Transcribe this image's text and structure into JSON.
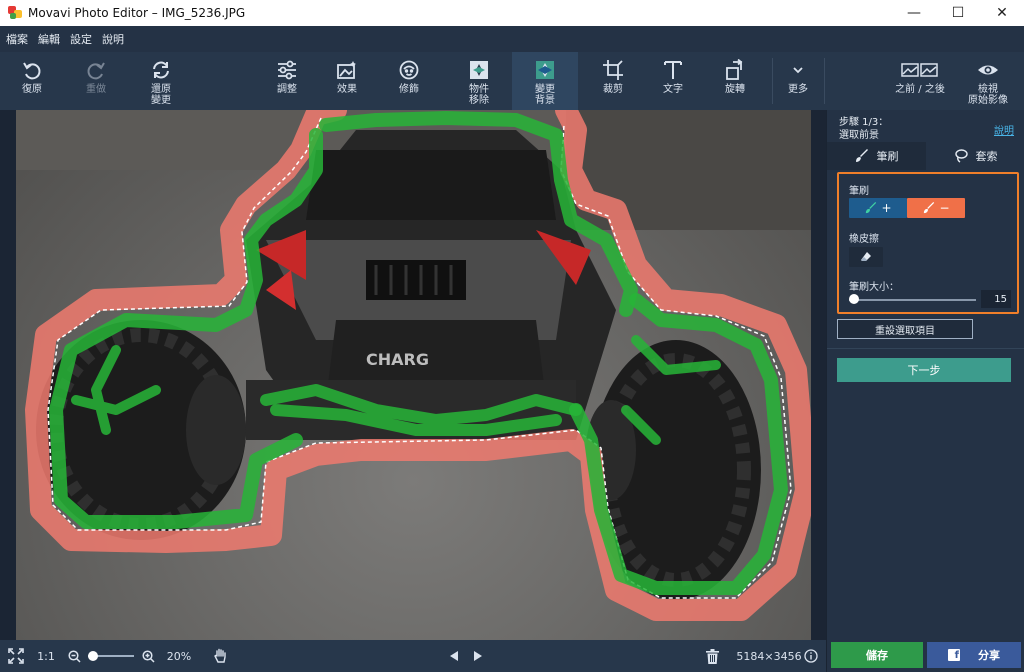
{
  "window": {
    "title": "Movavi Photo Editor – IMG_5236.JPG",
    "minimize": "—",
    "maximize": "☐",
    "close": "✕"
  },
  "menu": [
    "檔案",
    "編輯",
    "設定",
    "說明"
  ],
  "toolbar": {
    "undo": "復原",
    "redo": "重做",
    "restore": "還原\n變更",
    "adjust": "調整",
    "effects": "效果",
    "retouch": "修飾",
    "object_removal": "物件\n移除",
    "change_background": "變更\n背景",
    "crop": "裁剪",
    "text": "文字",
    "rotate": "旋轉",
    "more": "更多",
    "before_after": "之前 / 之後",
    "view_original": "檢視\n原始影像"
  },
  "panel": {
    "step_line1": "步驟 1/3：",
    "step_line2": "選取前景",
    "help": "說明",
    "tabs": [
      "筆刷",
      "套索"
    ],
    "brush_section": "筆刷",
    "brush_add": "+",
    "brush_remove": "−",
    "eraser_section": "橡皮擦",
    "brush_size_label": "筆刷大小：",
    "brush_size_value": "15",
    "brush_size_fraction": 0.04,
    "reset_selection": "重設選取項目",
    "next_step": "下一步",
    "save": "儲存",
    "share": "分享",
    "fb_letter": "f"
  },
  "bottom": {
    "fit_icon": "fit-screen-icon",
    "actual_size": "1:1",
    "zoom_value": "20%",
    "zoom_fraction": 0.1,
    "dimensions": "5184×3456"
  },
  "colors": {
    "accent_orange": "#f07f2a",
    "brush_add_bg": "#1e5c8e",
    "brush_remove_bg": "#f07048",
    "next_button": "#3d9c8d",
    "save_button": "#2e9a4a",
    "share_button": "#3a5a9b",
    "foreground_stroke": "#27b537",
    "background_stroke": "#f07a6e"
  }
}
